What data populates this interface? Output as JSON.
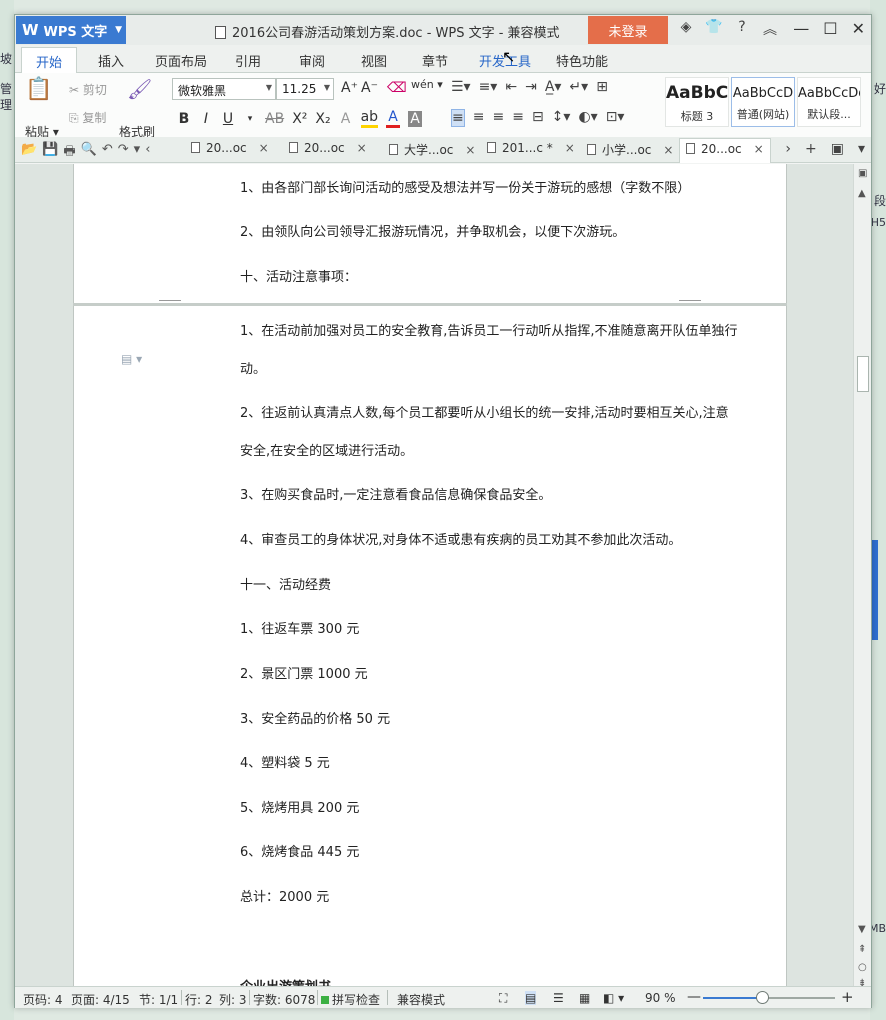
{
  "app": {
    "name": "WPS 文字",
    "window_title": "2016公司春游活动策划方案.doc - WPS 文字 - 兼容模式",
    "login_label": "未登录"
  },
  "ribbon_tabs": [
    "开始",
    "插入",
    "页面布局",
    "引用",
    "审阅",
    "视图",
    "章节",
    "开发工具",
    "特色功能"
  ],
  "ribbon": {
    "paste_label": "粘贴",
    "cut_label": "剪切",
    "copy_label": "复制",
    "format_painter_label": "格式刷",
    "font_name": "微软雅黑",
    "font_size": "11.25",
    "styles": [
      {
        "preview": "AaBbC",
        "label": "标题 3"
      },
      {
        "preview": "AaBbCcD",
        "label": "普通(网站)"
      },
      {
        "preview": "AaBbCcDd",
        "label": "默认段..."
      }
    ]
  },
  "doc_tabs": [
    {
      "label": "20...oc",
      "active": false
    },
    {
      "label": "20...oc",
      "active": false
    },
    {
      "label": "大学...oc",
      "active": false
    },
    {
      "label": "201...c *",
      "active": false
    },
    {
      "label": "小学...oc",
      "active": false
    },
    {
      "label": "20...oc",
      "active": true
    }
  ],
  "document": {
    "page1_paragraphs": [
      "1、由各部门部长询问活动的感受及想法并写一份关于游玩的感想（字数不限）",
      "2、由领队向公司领导汇报游玩情况，并争取机会，以便下次游玩。",
      "十、活动注意事项："
    ],
    "page2_paragraphs": [
      "1、在活动前加强对员工的安全教育,告诉员工一行动听从指挥,不准随意离开队伍单独行",
      "动。",
      "2、往返前认真清点人数,每个员工都要听从小组长的统一安排,活动时要相互关心,注意",
      "安全,在安全的区域进行活动。",
      "3、在购买食品时,一定注意看食品信息确保食品安全。",
      "4、审查员工的身体状况,对身体不适或患有疾病的员工劝其不参加此次活动。",
      "十一、活动经费",
      "1、往返车票 300 元",
      "2、景区门票 1000 元",
      "3、安全药品的价格 50 元",
      "4、塑料袋 5 元",
      "5、烧烤用具 200 元",
      "6、烧烤食品 445 元",
      "总计：2000 元",
      "企业出游策划书"
    ]
  },
  "status": {
    "page_code": "页码: 4",
    "pages": "页面: 4/15",
    "section": "节: 1/1",
    "row": "行: 2",
    "col": "列: 3",
    "word_count": "字数: 6078",
    "spell_check": "拼写检查",
    "compat_mode": "兼容模式",
    "zoom": "90 %",
    "zoom_fraction": 0.45
  },
  "desktop_fragments": {
    "left": [
      "坡",
      "管",
      "理"
    ],
    "right": [
      "好",
      "段",
      "H5",
      "MB"
    ]
  }
}
